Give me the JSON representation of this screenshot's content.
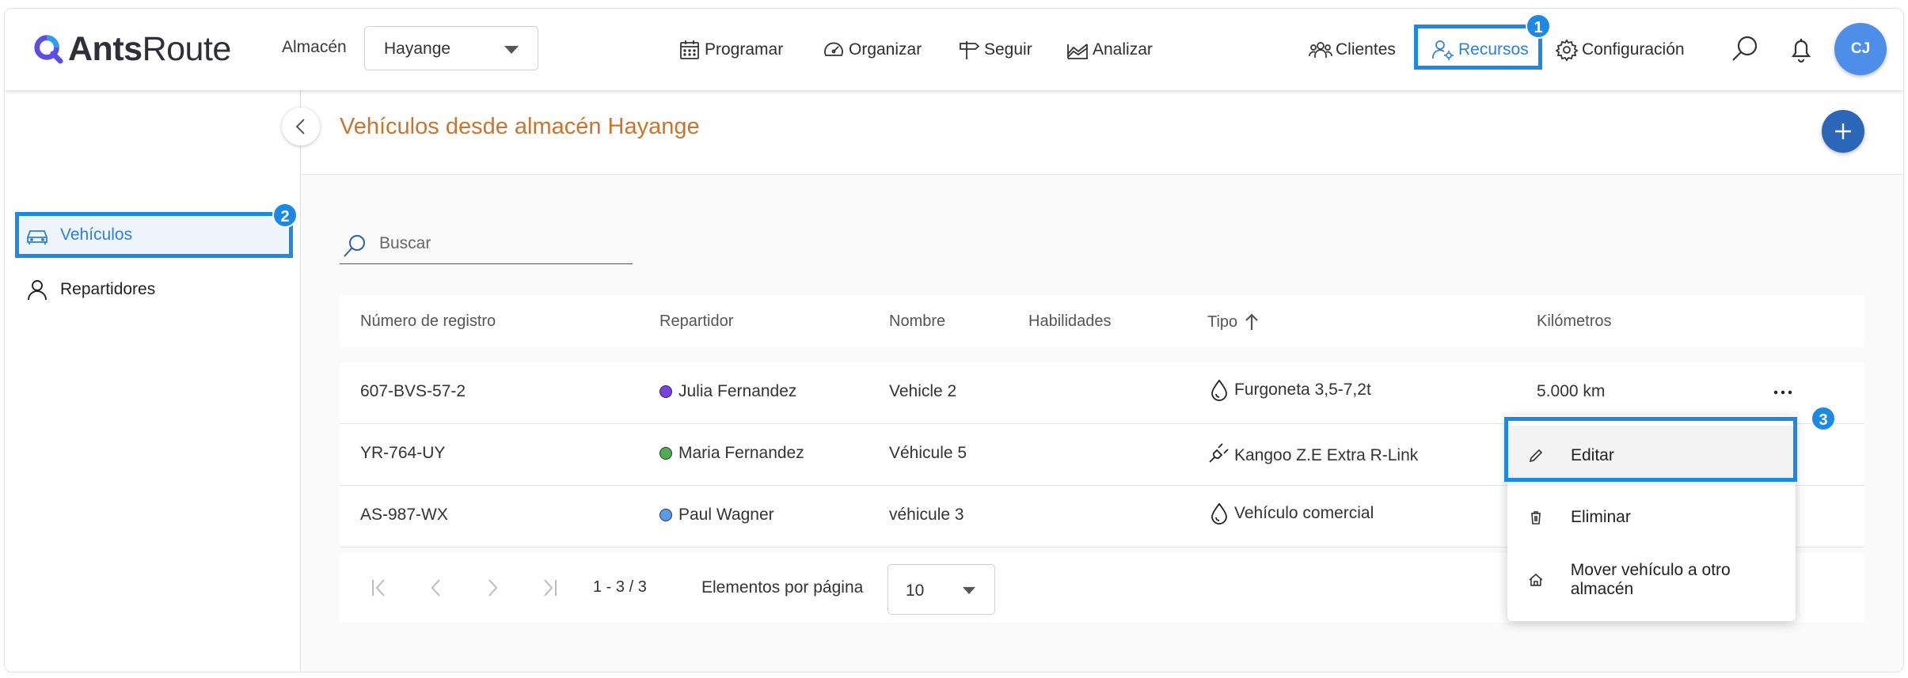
{
  "app": {
    "logo_bold": "Ants",
    "logo_light": "Route"
  },
  "header": {
    "warehouse_label": "Almacén",
    "warehouse_value": "Hayange",
    "nav": {
      "programar": "Programar",
      "organizar": "Organizar",
      "seguir": "Seguir",
      "analizar": "Analizar",
      "clientes": "Clientes",
      "recursos": "Recursos",
      "configuracion": "Configuración"
    },
    "avatar_initials": "CJ"
  },
  "sidebar": {
    "items": [
      {
        "label": "Vehículos",
        "icon": "car-icon",
        "active": true
      },
      {
        "label": "Repartidores",
        "icon": "person-icon",
        "active": false
      }
    ]
  },
  "main": {
    "title": "Vehículos desde almacén Hayange",
    "search_placeholder": "Buscar",
    "columns": [
      "Número de registro",
      "Repartidor",
      "Nombre",
      "Habilidades",
      "Tipo",
      "Kilómetros"
    ],
    "rows": [
      {
        "registration": "607-BVS-57-2",
        "driver": "Julia Fernandez",
        "driver_color": "#7b3fe4",
        "name": "Vehicle 2",
        "skills": "",
        "type": "Furgoneta 3,5-7,2t",
        "type_icon": "fuel-drop-icon",
        "km": "5.000 km"
      },
      {
        "registration": "YR-764-UY",
        "driver": "Maria Fernandez",
        "driver_color": "#4caf50",
        "name": "Véhicule 5",
        "skills": "",
        "type": "Kangoo Z.E Extra R-Link",
        "type_icon": "electric-plug-icon",
        "km": ""
      },
      {
        "registration": "AS-987-WX",
        "driver": "Paul Wagner",
        "driver_color": "#5a9bea",
        "name": "véhicule 3",
        "skills": "",
        "type": "Vehículo comercial",
        "type_icon": "fuel-drop-icon",
        "km": ""
      }
    ],
    "pagination": {
      "range": "1 - 3 / 3",
      "per_page_label": "Elementos por página",
      "per_page_value": "10"
    }
  },
  "context_menu": {
    "items": [
      {
        "label": "Editar",
        "icon": "pencil-icon"
      },
      {
        "label": "Eliminar",
        "icon": "trash-icon"
      },
      {
        "label": "Mover vehículo a otro almacén",
        "icon": "home-icon"
      }
    ]
  },
  "annotations": {
    "step1": "1",
    "step2": "2",
    "step3": "3"
  },
  "colors": {
    "accent": "#1e88e5",
    "title": "#c8752f",
    "add_button": "#2c66b8",
    "avatar": "#4d8fe8"
  }
}
